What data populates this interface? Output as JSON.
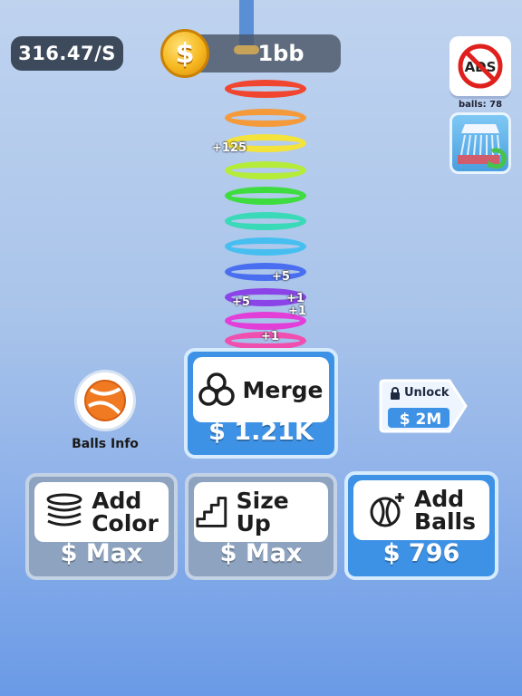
{
  "hud": {
    "rate": "316.47/S",
    "coins": "1bb",
    "coin_symbol": "$"
  },
  "side": {
    "ads_icon": "no-ads-icon",
    "ads_text": "ADS",
    "balls_count": "balls: 78",
    "shower_icon": "ball-shower-swap-icon"
  },
  "tower": {
    "floats": [
      "+125",
      "+5",
      "+5",
      "+1",
      "+1",
      "+1"
    ]
  },
  "merge": {
    "label": "Merge",
    "price": "$ 1.21K",
    "icon": "merge-circles-icon"
  },
  "unlock": {
    "label": "Unlock",
    "price": "$ 2M",
    "icon": "lock-icon"
  },
  "balls_info": {
    "label": "Balls Info",
    "icon": "beach-ball-icon"
  },
  "add_color": {
    "label_line1": "Add",
    "label_line2": "Color",
    "price": "$ Max",
    "icon": "stacked-rings-icon"
  },
  "size_up": {
    "label": "Size Up",
    "price": "$ Max",
    "icon": "stairs-icon"
  },
  "add_balls": {
    "label_line1": "Add",
    "label_line2": "Balls",
    "price": "$ 796",
    "icon": "ball-plus-icon"
  },
  "colors": {
    "card_gray": "#8ea3bf",
    "card_blue": "#3e92e6",
    "hud_dark": "#3c4a5c"
  }
}
